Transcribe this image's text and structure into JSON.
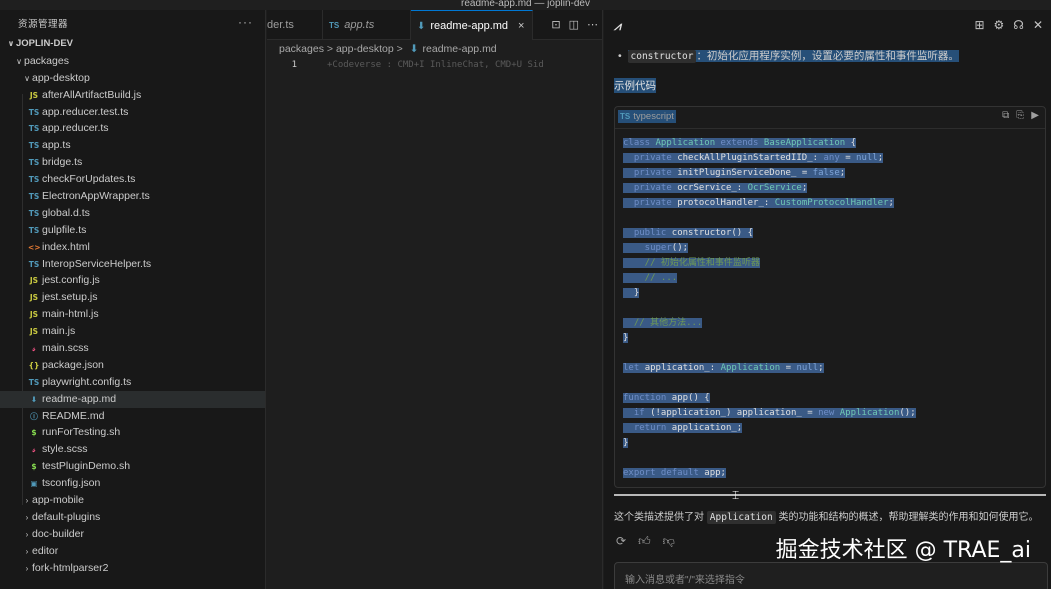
{
  "window": {
    "title": "readme-app.md — joplin-dev"
  },
  "explorer": {
    "header": "资源管理器",
    "more_label": "···",
    "items": [
      {
        "label": "JOPLIN-DEV",
        "chev": "∨",
        "icon": "",
        "icon_color": "",
        "depth": 0,
        "kind": "root"
      },
      {
        "label": "packages",
        "chev": "∨",
        "icon": "",
        "icon_color": "",
        "depth": 1,
        "kind": "folder"
      },
      {
        "label": "app-desktop",
        "chev": "∨",
        "icon": "",
        "icon_color": "",
        "depth": 2,
        "kind": "folder"
      },
      {
        "label": "afterAllArtifactBuild.js",
        "chev": "",
        "icon": "JS",
        "icon_color": "#cbcb41",
        "depth": 3,
        "kind": "file"
      },
      {
        "label": "app.reducer.test.ts",
        "chev": "",
        "icon": "TS",
        "icon_color": "#519aba",
        "depth": 3,
        "kind": "file"
      },
      {
        "label": "app.reducer.ts",
        "chev": "",
        "icon": "TS",
        "icon_color": "#519aba",
        "depth": 3,
        "kind": "file"
      },
      {
        "label": "app.ts",
        "chev": "",
        "icon": "TS",
        "icon_color": "#519aba",
        "depth": 3,
        "kind": "file"
      },
      {
        "label": "bridge.ts",
        "chev": "",
        "icon": "TS",
        "icon_color": "#519aba",
        "depth": 3,
        "kind": "file"
      },
      {
        "label": "checkForUpdates.ts",
        "chev": "",
        "icon": "TS",
        "icon_color": "#519aba",
        "depth": 3,
        "kind": "file"
      },
      {
        "label": "ElectronAppWrapper.ts",
        "chev": "",
        "icon": "TS",
        "icon_color": "#519aba",
        "depth": 3,
        "kind": "file"
      },
      {
        "label": "global.d.ts",
        "chev": "",
        "icon": "TS",
        "icon_color": "#519aba",
        "depth": 3,
        "kind": "file"
      },
      {
        "label": "gulpfile.ts",
        "chev": "",
        "icon": "TS",
        "icon_color": "#519aba",
        "depth": 3,
        "kind": "file"
      },
      {
        "label": "index.html",
        "chev": "",
        "icon": "<>",
        "icon_color": "#e37933",
        "depth": 3,
        "kind": "file"
      },
      {
        "label": "InteropServiceHelper.ts",
        "chev": "",
        "icon": "TS",
        "icon_color": "#519aba",
        "depth": 3,
        "kind": "file"
      },
      {
        "label": "jest.config.js",
        "chev": "",
        "icon": "JS",
        "icon_color": "#cbcb41",
        "depth": 3,
        "kind": "file"
      },
      {
        "label": "jest.setup.js",
        "chev": "",
        "icon": "JS",
        "icon_color": "#cbcb41",
        "depth": 3,
        "kind": "file"
      },
      {
        "label": "main-html.js",
        "chev": "",
        "icon": "JS",
        "icon_color": "#cbcb41",
        "depth": 3,
        "kind": "file"
      },
      {
        "label": "main.js",
        "chev": "",
        "icon": "JS",
        "icon_color": "#cbcb41",
        "depth": 3,
        "kind": "file"
      },
      {
        "label": "main.scss",
        "chev": "",
        "icon": "𝓈",
        "icon_color": "#f55385",
        "depth": 3,
        "kind": "file"
      },
      {
        "label": "package.json",
        "chev": "",
        "icon": "{}",
        "icon_color": "#cbcb41",
        "depth": 3,
        "kind": "file"
      },
      {
        "label": "playwright.config.ts",
        "chev": "",
        "icon": "TS",
        "icon_color": "#519aba",
        "depth": 3,
        "kind": "file"
      },
      {
        "label": "readme-app.md",
        "chev": "",
        "icon": "⬇",
        "icon_color": "#519aba",
        "depth": 3,
        "kind": "file",
        "selected": true
      },
      {
        "label": "README.md",
        "chev": "",
        "icon": "ⓘ",
        "icon_color": "#519aba",
        "depth": 3,
        "kind": "file"
      },
      {
        "label": "runForTesting.sh",
        "chev": "",
        "icon": "$",
        "icon_color": "#89e051",
        "depth": 3,
        "kind": "file"
      },
      {
        "label": "style.scss",
        "chev": "",
        "icon": "𝓈",
        "icon_color": "#f55385",
        "depth": 3,
        "kind": "file"
      },
      {
        "label": "testPluginDemo.sh",
        "chev": "",
        "icon": "$",
        "icon_color": "#89e051",
        "depth": 3,
        "kind": "file"
      },
      {
        "label": "tsconfig.json",
        "chev": "",
        "icon": "▣",
        "icon_color": "#519aba",
        "depth": 3,
        "kind": "file"
      },
      {
        "label": "app-mobile",
        "chev": "›",
        "icon": "",
        "icon_color": "",
        "depth": 2,
        "kind": "folder"
      },
      {
        "label": "default-plugins",
        "chev": "›",
        "icon": "",
        "icon_color": "",
        "depth": 2,
        "kind": "folder"
      },
      {
        "label": "doc-builder",
        "chev": "›",
        "icon": "",
        "icon_color": "",
        "depth": 2,
        "kind": "folder"
      },
      {
        "label": "editor",
        "chev": "›",
        "icon": "",
        "icon_color": "",
        "depth": 2,
        "kind": "folder"
      },
      {
        "label": "fork-htmlparser2",
        "chev": "›",
        "icon": "",
        "icon_color": "",
        "depth": 2,
        "kind": "folder"
      }
    ]
  },
  "editor": {
    "tabs": [
      {
        "label": "der.ts",
        "icon": "",
        "active": false
      },
      {
        "label": "app.ts",
        "icon": "TS",
        "active": false
      },
      {
        "label": "readme-app.md",
        "icon": "⬇",
        "active": true
      }
    ],
    "tab_close": "×",
    "breadcrumb": {
      "part1": "packages",
      "sep": ">",
      "part2": "app-desktop",
      "file": "readme-app.md"
    },
    "line_number": "1",
    "ghost_hint": "+Codeverse : CMD+I InlineChat, CMD+U Sid"
  },
  "chat": {
    "bullet_code": "constructor",
    "bullet_text": "：初始化应用程序实例，设置必要的属性和事件监听器。",
    "example_label": "示例代码",
    "code_lang_badge": "TS",
    "code_lang": "typescript",
    "code_lines": [
      [
        [
          "kw",
          "class "
        ],
        [
          "ty",
          "Application "
        ],
        [
          "kw",
          "extends "
        ],
        [
          "ty",
          "BaseApplication "
        ],
        [
          "",
          "{"
        ]
      ],
      [
        [
          "kw",
          "  private "
        ],
        [
          "",
          "checkAllPluginStartedIID_"
        ],
        [
          "",
          ": "
        ],
        [
          "kw",
          "any "
        ],
        [
          "",
          "= "
        ],
        [
          "bn",
          "null"
        ],
        [
          "",
          ";"
        ]
      ],
      [
        [
          "kw",
          "  private "
        ],
        [
          "",
          "initPluginServiceDone_ "
        ],
        [
          "",
          "= "
        ],
        [
          "bn",
          "false"
        ],
        [
          "",
          ";"
        ]
      ],
      [
        [
          "kw",
          "  private "
        ],
        [
          "",
          "ocrService_"
        ],
        [
          "",
          ": "
        ],
        [
          "ty",
          "OcrService"
        ],
        [
          "",
          ";"
        ]
      ],
      [
        [
          "kw",
          "  private "
        ],
        [
          "",
          "protocolHandler_"
        ],
        [
          "",
          ": "
        ],
        [
          "ty",
          "CustomProtocolHandler"
        ],
        [
          "",
          ";"
        ]
      ],
      [],
      [
        [
          "kw",
          "  public "
        ],
        [
          "",
          "constructor() {"
        ]
      ],
      [
        [
          "kw",
          "    super"
        ],
        [
          "",
          "();"
        ]
      ],
      [
        [
          "cm",
          "    // 初始化属性和事件监听器"
        ]
      ],
      [
        [
          "cm",
          "    // ..."
        ]
      ],
      [
        [
          "",
          "  }"
        ]
      ],
      [],
      [
        [
          "cm",
          "  // 其他方法..."
        ]
      ],
      [
        [
          "",
          "}"
        ]
      ],
      [],
      [
        [
          "kw",
          "let "
        ],
        [
          "",
          "application_"
        ],
        [
          "",
          ": "
        ],
        [
          "ty",
          "Application "
        ],
        [
          "",
          "= "
        ],
        [
          "bn",
          "null"
        ],
        [
          "",
          ";"
        ]
      ],
      [],
      [
        [
          "kw",
          "function "
        ],
        [
          "",
          "app() {"
        ]
      ],
      [
        [
          "kw",
          "  if "
        ],
        [
          "",
          "(!application_) application_ = "
        ],
        [
          "kw",
          "new "
        ],
        [
          "ty",
          "Application"
        ],
        [
          "",
          "();"
        ]
      ],
      [
        [
          "kw",
          "  return "
        ],
        [
          "",
          "application_;"
        ]
      ],
      [
        [
          "",
          "}"
        ]
      ],
      [],
      [
        [
          "kw",
          "export default "
        ],
        [
          "",
          "app;"
        ]
      ]
    ],
    "summary_prefix": "这个类描述提供了对 ",
    "summary_code": "Application",
    "summary_suffix": " 类的功能和结构的概述，帮助理解类的作用和如何使用它。",
    "input_placeholder": "输入消息或者\"/\"来选择指令",
    "watermark": "掘金技术社区 @ TRAE_ai"
  },
  "colors": {
    "accent": "#0078d4",
    "selection": "#264f78",
    "code_selection": "#3a5a86"
  }
}
